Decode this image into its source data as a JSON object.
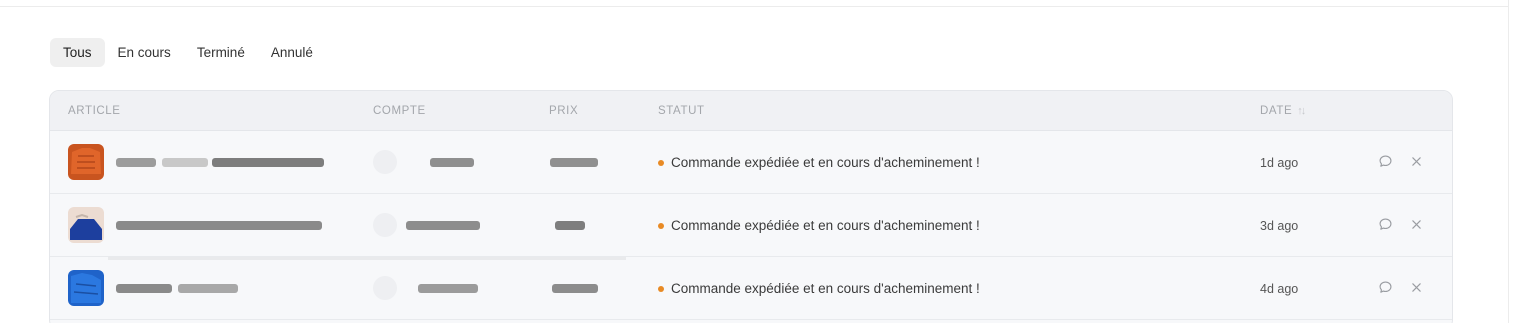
{
  "tabs": [
    {
      "label": "Tous",
      "active": true
    },
    {
      "label": "En cours",
      "active": false
    },
    {
      "label": "Terminé",
      "active": false
    },
    {
      "label": "Annulé",
      "active": false
    }
  ],
  "table": {
    "columns": {
      "article": "ARTICLE",
      "compte": "COMPTE",
      "prix": "PRIX",
      "statut": "STATUT",
      "date": "DATE"
    },
    "rows": [
      {
        "status": "Commande expédiée et en cours d'acheminement !",
        "date": "1d ago",
        "thumb": "orange-garment"
      },
      {
        "status": "Commande expédiée et en cours d'acheminement !",
        "date": "3d ago",
        "thumb": "blue-garment-white-bg"
      },
      {
        "status": "Commande expédiée et en cours d'acheminement !",
        "date": "4d ago",
        "thumb": "blue-garment"
      }
    ]
  },
  "colors": {
    "status_dot": "#e88a24",
    "active_tab_bg": "#efefef",
    "header_bg": "#f0f1f4"
  },
  "icons": [
    "comment-icon",
    "close-icon",
    "sort-icon"
  ]
}
